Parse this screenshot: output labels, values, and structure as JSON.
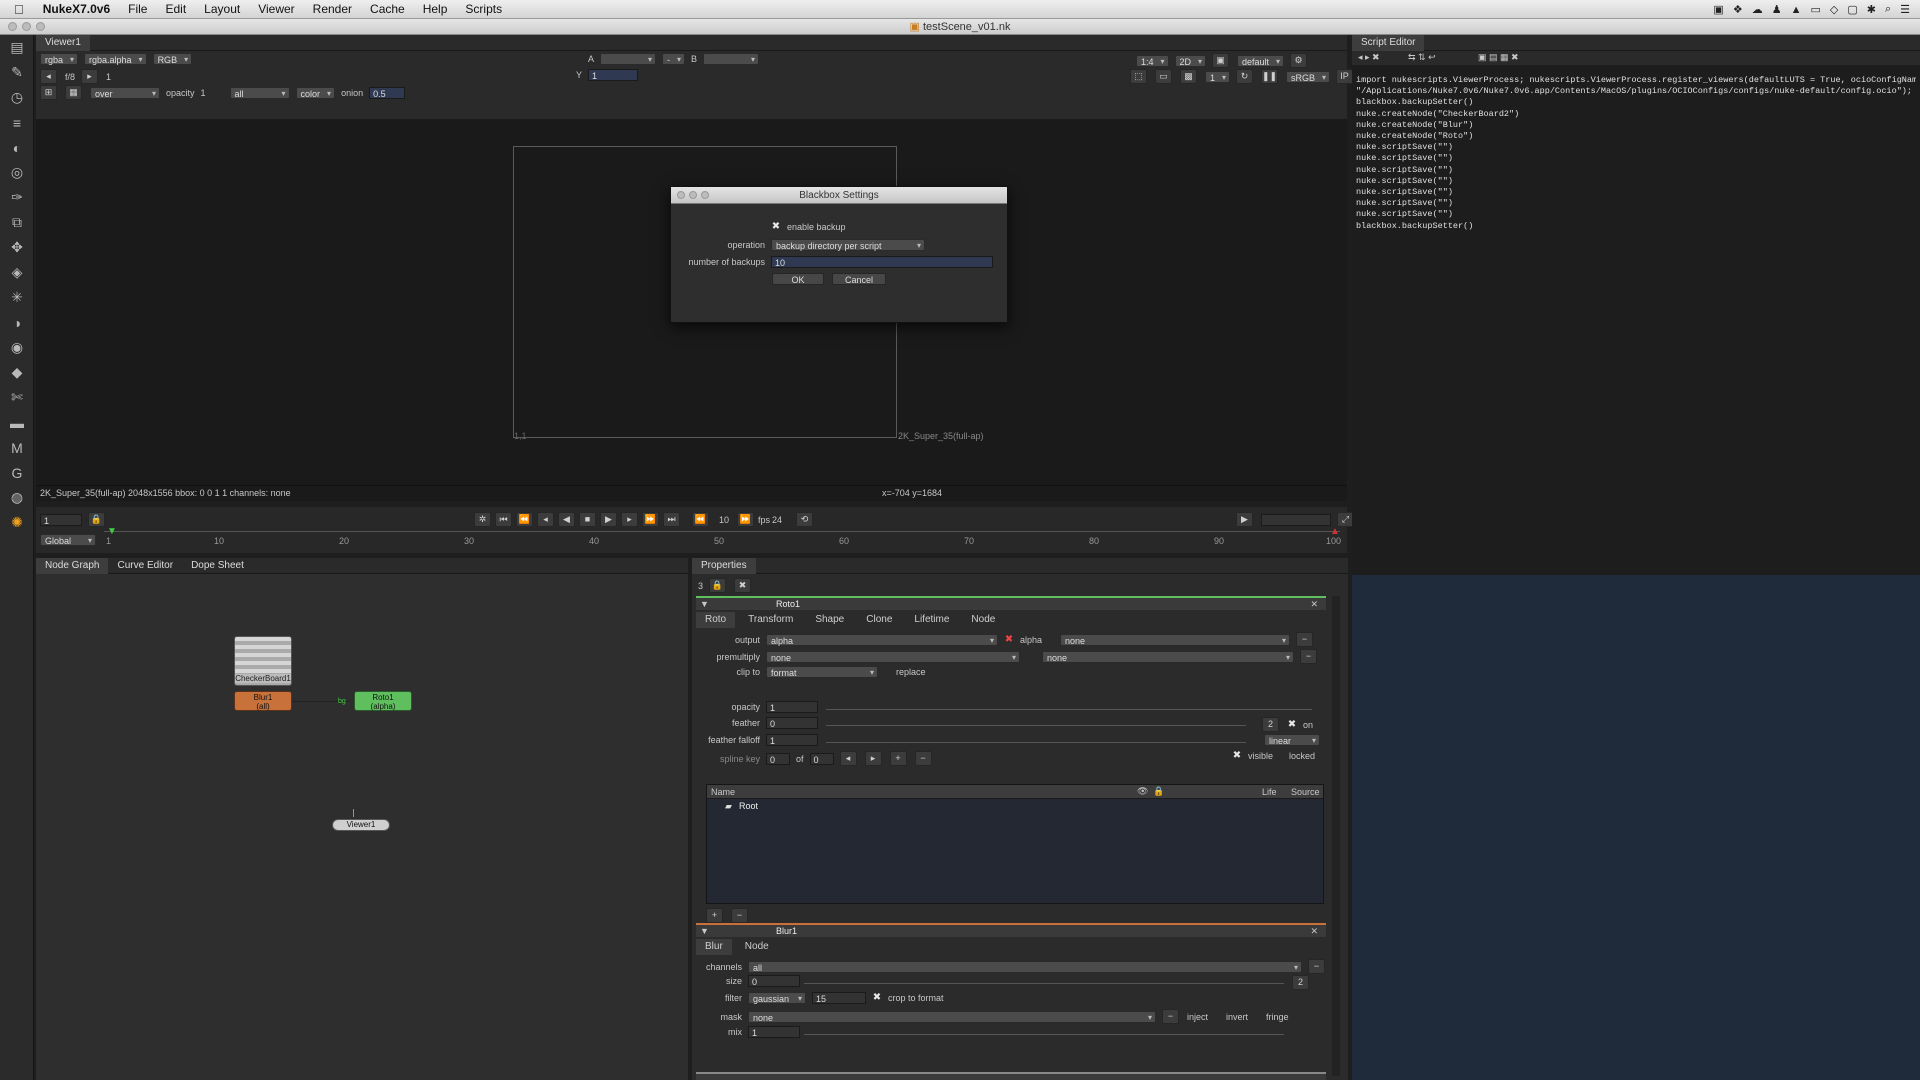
{
  "menubar": {
    "apple": "",
    "app": "NukeX7.0v6",
    "items": [
      "File",
      "Edit",
      "Layout",
      "Viewer",
      "Render",
      "Cache",
      "Help",
      "Scripts"
    ]
  },
  "window": {
    "title": "testScene_v01.nk"
  },
  "viewer": {
    "tab": "Viewer1",
    "channels": "rgba",
    "layer": "rgba.alpha",
    "display": "RGB",
    "a_label": "A",
    "a_input": "-",
    "a_op": "-",
    "b_label": "B",
    "zoom": "1:4",
    "mode": "2D",
    "lut": "default",
    "fstop": "f/8",
    "frame_val": "1",
    "y_label": "Y",
    "y_val": "1",
    "gain": "1",
    "colorspace": "sRGB",
    "composite": "over",
    "opacity_label": "opacity",
    "opacity_val": "1",
    "wipe": "all",
    "color": "color",
    "onion_label": "onion",
    "onion_val": "0.5",
    "format_label": "2K_Super_35(full-ap)",
    "corner_label": "1,1",
    "status": "2K_Super_35(full-ap) 2048x1556  bbox: 0 0 1 1 channels: none",
    "coords": "x=-704 y=1684"
  },
  "timeline": {
    "frame": "1",
    "scope": "Global",
    "ticks": [
      "1",
      "10",
      "20",
      "30",
      "40",
      "50",
      "60",
      "70",
      "80",
      "90",
      "100"
    ],
    "increment": "10",
    "fps_label": "fps",
    "fps_val": "24",
    "end": "100"
  },
  "dialog": {
    "title": "Blackbox Settings",
    "enable_label": "enable backup",
    "operation_label": "operation",
    "operation_val": "backup directory per script",
    "number_label": "number of backups",
    "number_val": "10",
    "ok": "OK",
    "cancel": "Cancel"
  },
  "script_editor": {
    "tab": "Script Editor",
    "lines": [
      "import nukescripts.ViewerProcess; nukescripts.ViewerProcess.register_viewers(defaultLUTS = True, ocioConfigName =",
      "\"/Applications/Nuke7.0v6/Nuke7.0v6.app/Contents/MacOS/plugins/OCIOConfigs/configs/nuke-default/config.ocio\");",
      "blackbox.backupSetter()",
      "nuke.createNode(\"CheckerBoard2\")",
      "nuke.createNode(\"Blur\")",
      "nuke.createNode(\"Roto\")",
      "nuke.scriptSave(\"\")",
      "nuke.scriptSave(\"\")",
      "nuke.scriptSave(\"\")",
      "nuke.scriptSave(\"\")",
      "nuke.scriptSave(\"\")",
      "nuke.scriptSave(\"\")",
      "nuke.scriptSave(\"\")",
      "blackbox.backupSetter()"
    ]
  },
  "nodegraph": {
    "tabs": [
      "Node Graph",
      "Curve Editor",
      "Dope Sheet"
    ],
    "checker": "CheckerBoard1",
    "blur": "Blur1",
    "blur_sub": "(all)",
    "roto": "Roto1",
    "roto_sub": "(alpha)",
    "viewer": "Viewer1",
    "pipe_label": "bg"
  },
  "properties": {
    "tab": "Properties",
    "count": "3",
    "roto": {
      "name": "Roto1",
      "tabs": [
        "Roto",
        "Transform",
        "Shape",
        "Clone",
        "Lifetime",
        "Node"
      ],
      "output_label": "output",
      "output_val": "alpha",
      "alpha_label": "alpha",
      "out2": "none",
      "premult_label": "premultiply",
      "premult_val": "none",
      "premult2": "none",
      "clip_label": "clip to",
      "clip_val": "format",
      "replace": "replace",
      "opacity_label": "opacity",
      "opacity_val": "1",
      "feather_label": "feather",
      "feather_val": "0",
      "falloff_label": "feather falloff",
      "falloff_val": "1",
      "falloff_type": "linear",
      "spline_label": "spline key",
      "spline_val": "0",
      "of_label": "of",
      "of_val": "0",
      "on_label": "on",
      "visible_label": "visible",
      "locked_label": "locked",
      "tbl_name": "Name",
      "tbl_life": "Life",
      "tbl_source": "Source",
      "root": "Root",
      "fr_num": "2"
    },
    "blur": {
      "name": "Blur1",
      "tabs": [
        "Blur",
        "Node"
      ],
      "channels_label": "channels",
      "channels_val": "all",
      "size_label": "size",
      "size_val": "0",
      "size_num": "2",
      "filter_label": "filter",
      "filter_val": "gaussian",
      "filter_num": "15",
      "crop_label": "crop to format",
      "mask_label": "mask",
      "mask_val": "none",
      "inject": "inject",
      "invert": "invert",
      "fringe": "fringe",
      "mix_label": "mix",
      "mix_val": "1"
    },
    "checker": {
      "name": "CheckerBoard1"
    }
  }
}
